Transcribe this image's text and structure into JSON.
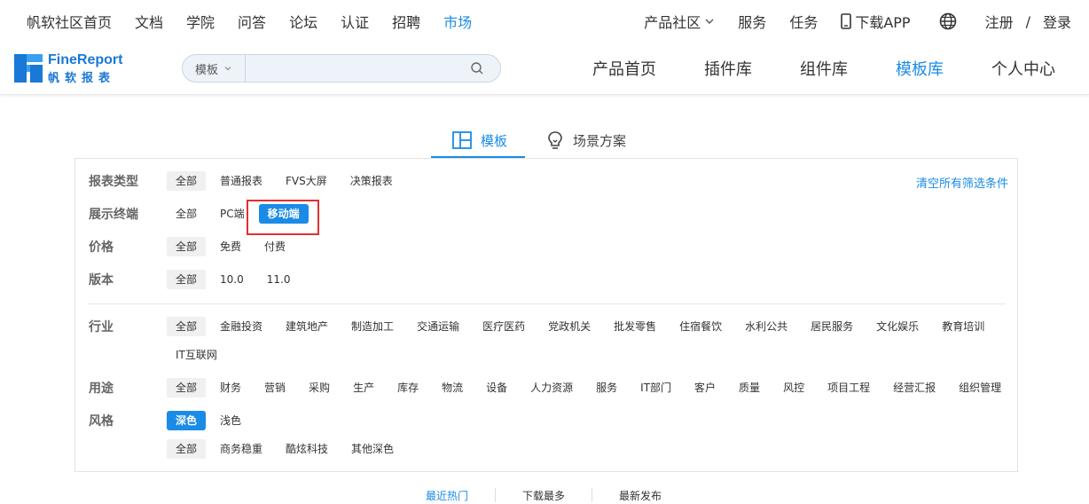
{
  "topnav": {
    "left": [
      "帆软社区首页",
      "文档",
      "学院",
      "问答",
      "论坛",
      "认证",
      "招聘",
      "市场"
    ],
    "active_index": 7,
    "product_community": "产品社区",
    "service": "服务",
    "task": "任务",
    "download_app": "下载APP",
    "register": "注册",
    "slash": "/",
    "login": "登录"
  },
  "logo": {
    "name": "FineReport",
    "subtitle": "帆软报表"
  },
  "search": {
    "scope": "模板",
    "placeholder": ""
  },
  "mainnav": {
    "items": [
      "产品首页",
      "插件库",
      "组件库",
      "模板库",
      "个人中心"
    ],
    "active_index": 3
  },
  "tabs": {
    "template": "模板",
    "scenario": "场景方案"
  },
  "filters": {
    "clear_all": "清空所有筛选条件",
    "report_type": {
      "label": "报表类型",
      "options": [
        "全部",
        "普通报表",
        "FVS大屏",
        "决策报表"
      ]
    },
    "terminal": {
      "label": "展示终端",
      "options": [
        "全部",
        "PC端",
        "移动端"
      ]
    },
    "price": {
      "label": "价格",
      "options": [
        "全部",
        "免费",
        "付费"
      ]
    },
    "version": {
      "label": "版本",
      "options": [
        "全部",
        "10.0",
        "11.0"
      ]
    },
    "industry": {
      "label": "行业",
      "options": [
        "全部",
        "金融投资",
        "建筑地产",
        "制造加工",
        "交通运输",
        "医疗医药",
        "党政机关",
        "批发零售",
        "住宿餐饮",
        "水利公共",
        "居民服务",
        "文化娱乐",
        "教育培训"
      ],
      "options_row2": [
        "IT互联网"
      ]
    },
    "usage": {
      "label": "用途",
      "options": [
        "全部",
        "财务",
        "营销",
        "采购",
        "生产",
        "库存",
        "物流",
        "设备",
        "人力资源",
        "服务",
        "IT部门",
        "客户",
        "质量",
        "风控",
        "项目工程",
        "经营汇报",
        "组织管理"
      ]
    },
    "style": {
      "label": "风格",
      "options": [
        "深色",
        "浅色"
      ],
      "sub_options": [
        "全部",
        "商务稳重",
        "酷炫科技",
        "其他深色"
      ]
    }
  },
  "sort": {
    "hot": "最近热门",
    "downloads": "下载最多",
    "latest": "最新发布"
  },
  "colors": {
    "accent": "#1a8be6",
    "highlight_box": "#e23030"
  }
}
